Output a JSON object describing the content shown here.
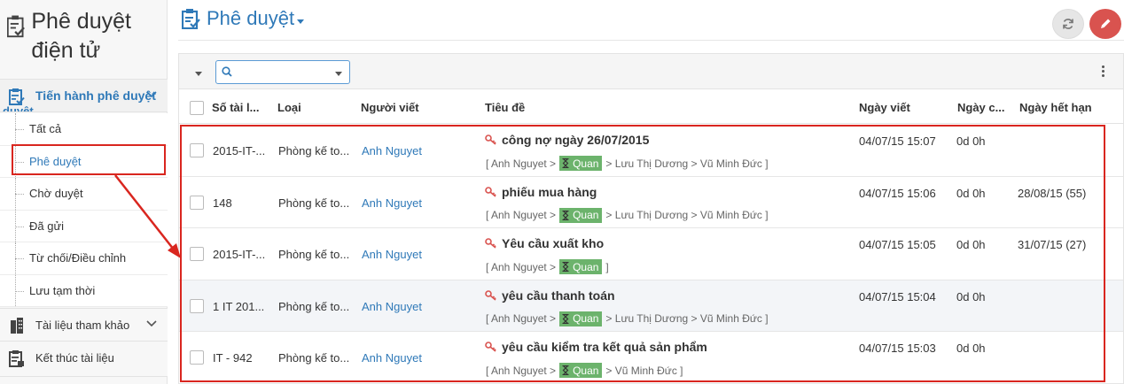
{
  "app": {
    "title": "Phê duyệt điện tử"
  },
  "sidebar": {
    "active_group": {
      "label": "Tiến hành phê duyệt",
      "overflow": "duyệt"
    },
    "items": [
      {
        "label": "Tất cả"
      },
      {
        "label": "Phê duyệt"
      },
      {
        "label": "Chờ duyệt"
      },
      {
        "label": "Đã gửi"
      },
      {
        "label": "Từ chối/Điều chỉnh"
      },
      {
        "label": "Lưu tạm thời"
      }
    ],
    "groups": [
      {
        "label": "Tài liệu tham khảo"
      },
      {
        "label": "Kết thúc tài liệu"
      }
    ]
  },
  "header": {
    "title": "Phê duyệt"
  },
  "search": {
    "value": "",
    "placeholder": ""
  },
  "table": {
    "columns": {
      "doc_no": "Số tài l...",
      "type": "Loại",
      "writer": "Người viết",
      "subject": "Tiêu đề",
      "written_date": "Ngày viết",
      "duration": "Ngày c...",
      "expiry": "Ngày hết hạn"
    },
    "rows": [
      {
        "doc_no": "2015-IT-...",
        "type": "Phòng kế to...",
        "writer": "Anh Nguyet",
        "subject": "công nợ ngày 26/07/2015",
        "flow_start": "[ Anh Nguyet >",
        "badge": "Quan",
        "flow_end": "> Lưu Thị Dương > Vũ Minh Đức ]",
        "date": "04/07/15 15:07",
        "duration": "0d 0h",
        "expiry": ""
      },
      {
        "doc_no": "148",
        "type": "Phòng kế to...",
        "writer": "Anh Nguyet",
        "subject": "phiếu mua hàng",
        "flow_start": "[ Anh Nguyet >",
        "badge": "Quan",
        "flow_end": "> Lưu Thị Dương > Vũ Minh Đức ]",
        "date": "04/07/15 15:06",
        "duration": "0d 0h",
        "expiry": "28/08/15 (55)"
      },
      {
        "doc_no": "2015-IT-...",
        "type": "Phòng kế to...",
        "writer": "Anh Nguyet",
        "subject": "Yêu cầu xuất kho",
        "flow_start": "[ Anh Nguyet >",
        "badge": "Quan",
        "flow_end": "]",
        "date": "04/07/15 15:05",
        "duration": "0d 0h",
        "expiry": "31/07/15 (27)"
      },
      {
        "doc_no": "1 IT 201...",
        "type": "Phòng kế to...",
        "writer": "Anh Nguyet",
        "subject": "yêu cầu thanh toán",
        "flow_start": "[ Anh Nguyet >",
        "badge": "Quan",
        "flow_end": "> Lưu Thị Dương > Vũ Minh Đức ]",
        "date": "04/07/15 15:04",
        "duration": "0d 0h",
        "expiry": ""
      },
      {
        "doc_no": "IT - 942",
        "type": "Phòng kế to...",
        "writer": "Anh Nguyet",
        "subject": "yêu cầu kiểm tra kết quả sản phẩm",
        "flow_start": "[ Anh Nguyet >",
        "badge": "Quan",
        "flow_end": "> Vũ Minh Đức ]",
        "date": "04/07/15 15:03",
        "duration": "0d 0h",
        "expiry": ""
      }
    ]
  },
  "colors": {
    "accent": "#2f79b8",
    "annotation": "#d9261f",
    "badge": "#6cb36c",
    "edit_button": "#d9534f"
  }
}
